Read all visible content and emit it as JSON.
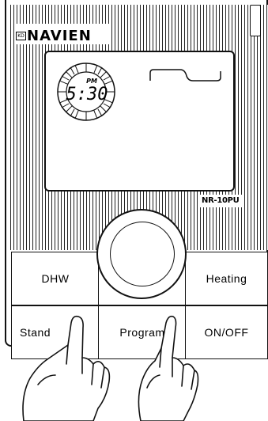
{
  "brand": {
    "name": "NAVIEN",
    "badge": "KD"
  },
  "model": "NR-10PU",
  "display": {
    "time": "5:30",
    "period": "PM"
  },
  "buttons": {
    "dhw": "DHW",
    "heating": "Heating",
    "standby": "Stand",
    "program": "Program",
    "onoff": "ON/OFF"
  },
  "icons": [
    "dial-knob",
    "hand-pointer-icon",
    "sun-dial-icon"
  ]
}
